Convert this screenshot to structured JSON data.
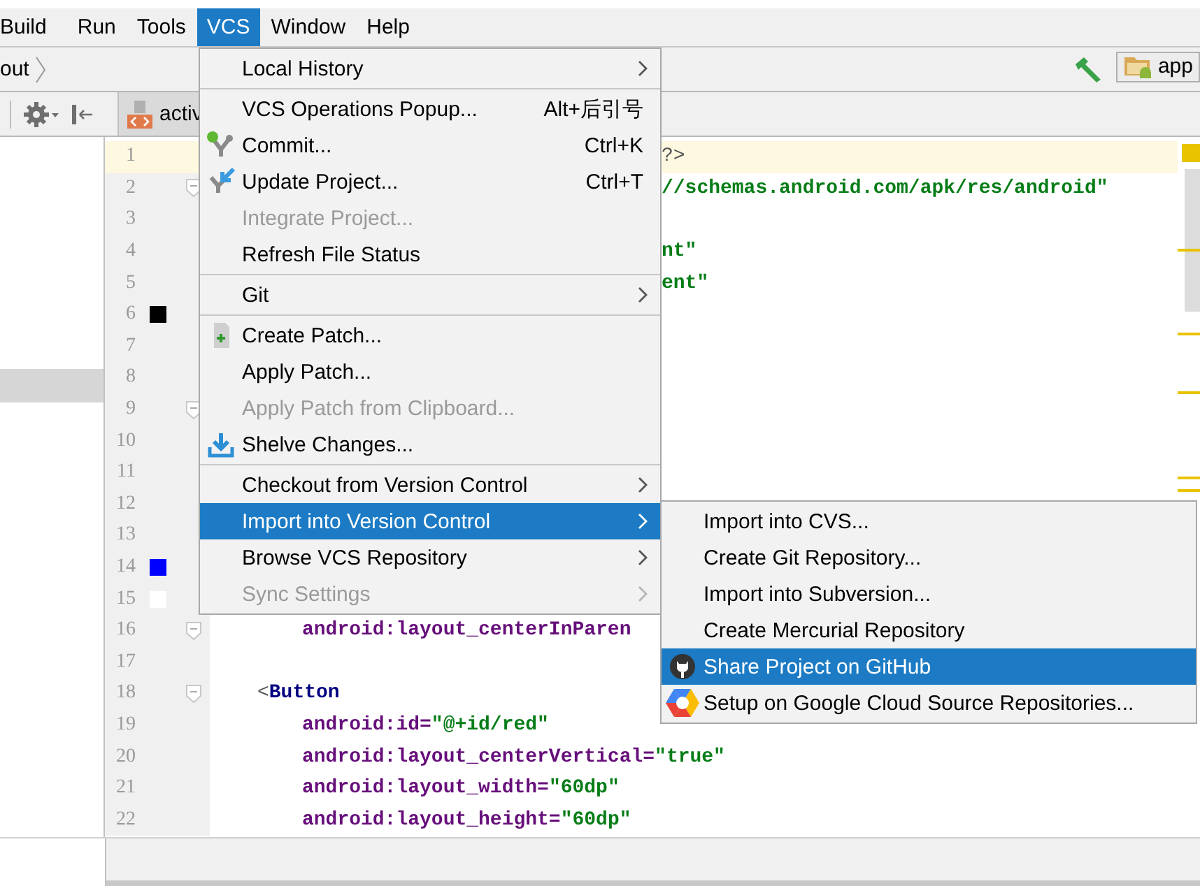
{
  "menubar": [
    {
      "label": "Build",
      "selected": false
    },
    {
      "label": "Run",
      "selected": false
    },
    {
      "label": "Tools",
      "selected": false
    },
    {
      "label": "VCS",
      "selected": true
    },
    {
      "label": "Window",
      "selected": false
    },
    {
      "label": "Help",
      "selected": false
    }
  ],
  "breadcrumb": "out",
  "run_config": "app",
  "tabs": [
    {
      "label": "activ",
      "selected": true
    }
  ],
  "editor": {
    "lines": [
      {
        "number": "1",
        "kind": "tail",
        "current": true,
        "fold": false,
        "parts": [
          {
            "kind": "punct",
            "text": "?>"
          }
        ]
      },
      {
        "number": "2",
        "kind": "tail",
        "current": false,
        "fold": true,
        "parts": [
          {
            "kind": "value",
            "text": "//schemas.android.com/apk/res/android\""
          }
        ]
      },
      {
        "number": "3",
        "kind": "tail",
        "current": false,
        "fold": false
      },
      {
        "number": "4",
        "kind": "tail",
        "current": false,
        "fold": false,
        "parts": [
          {
            "kind": "value",
            "text": "nt\""
          }
        ]
      },
      {
        "number": "5",
        "kind": "tail",
        "current": false,
        "fold": false,
        "parts": [
          {
            "kind": "value",
            "text": "ent\""
          }
        ]
      },
      {
        "number": "6",
        "kind": "tail",
        "current": false,
        "fold": false,
        "color": "#000000"
      },
      {
        "number": "7",
        "kind": "tail",
        "current": false,
        "fold": false
      },
      {
        "number": "8",
        "kind": "tail",
        "current": false,
        "fold": false
      },
      {
        "number": "9",
        "kind": "tail",
        "current": false,
        "fold": true
      },
      {
        "number": "10",
        "kind": "tail",
        "current": false,
        "fold": false
      },
      {
        "number": "11",
        "kind": "tail",
        "current": false,
        "fold": false
      },
      {
        "number": "12",
        "kind": "tail",
        "current": false,
        "fold": false
      },
      {
        "number": "13",
        "kind": "tail",
        "current": false,
        "fold": false
      },
      {
        "number": "14",
        "kind": "tail",
        "current": false,
        "fold": false,
        "color": "#0000ff"
      },
      {
        "number": "15",
        "kind": "tail",
        "current": false,
        "fold": false,
        "color": "#ffffff"
      },
      {
        "number": "16",
        "kind": "attr",
        "current": false,
        "fold": true,
        "parts": [
          {
            "kind": "attr",
            "text": "android:layout_centerInParen"
          }
        ]
      },
      {
        "number": "17",
        "kind": "attr",
        "current": false,
        "fold": false
      },
      {
        "number": "18",
        "kind": "tag",
        "current": false,
        "fold": true,
        "parts": [
          {
            "kind": "punct",
            "text": "<"
          },
          {
            "kind": "tag",
            "text": "Button"
          }
        ]
      },
      {
        "number": "19",
        "kind": "attr",
        "current": false,
        "fold": false,
        "parts": [
          {
            "kind": "attr",
            "text": "android:id="
          },
          {
            "kind": "value",
            "text": "\"@+id/red\""
          }
        ]
      },
      {
        "number": "20",
        "kind": "attr",
        "current": false,
        "fold": false,
        "parts": [
          {
            "kind": "attr",
            "text": "android:layout_centerVertical="
          },
          {
            "kind": "value",
            "text": "\"true\""
          }
        ]
      },
      {
        "number": "21",
        "kind": "attr",
        "current": false,
        "fold": false,
        "parts": [
          {
            "kind": "attr",
            "text": "android:layout_width="
          },
          {
            "kind": "value",
            "text": "\"60dp\""
          }
        ]
      },
      {
        "number": "22",
        "kind": "attr",
        "current": false,
        "fold": false,
        "parts": [
          {
            "kind": "attr",
            "text": "android:layout_height="
          },
          {
            "kind": "value",
            "text": "\"60dp\""
          }
        ]
      }
    ]
  },
  "vcs_menu": {
    "items": [
      {
        "kind": "item",
        "label": "Local History",
        "submenu": true,
        "disabled": false,
        "selected": false
      },
      {
        "kind": "separator"
      },
      {
        "kind": "item",
        "label": "VCS Operations Popup...",
        "shortcut": "Alt+后引号",
        "submenu": false,
        "disabled": false,
        "selected": false
      },
      {
        "kind": "commit",
        "label": "Commit...",
        "shortcut": "Ctrl+K",
        "submenu": false,
        "disabled": false,
        "selected": false
      },
      {
        "kind": "update",
        "label": "Update Project...",
        "shortcut": "Ctrl+T",
        "submenu": false,
        "disabled": false,
        "selected": false
      },
      {
        "kind": "item",
        "label": "Integrate Project...",
        "submenu": false,
        "disabled": true,
        "selected": false
      },
      {
        "kind": "item",
        "label": "Refresh File Status",
        "submenu": false,
        "disabled": false,
        "selected": false
      },
      {
        "kind": "separator"
      },
      {
        "kind": "item",
        "label": "Git",
        "submenu": true,
        "disabled": false,
        "selected": false
      },
      {
        "kind": "separator"
      },
      {
        "kind": "patch",
        "label": "Create Patch...",
        "submenu": false,
        "disabled": false,
        "selected": false
      },
      {
        "kind": "item",
        "label": "Apply Patch...",
        "submenu": false,
        "disabled": false,
        "selected": false
      },
      {
        "kind": "item",
        "label": "Apply Patch from Clipboard...",
        "submenu": false,
        "disabled": true,
        "selected": false
      },
      {
        "kind": "shelve",
        "label": "Shelve Changes...",
        "submenu": false,
        "disabled": false,
        "selected": false
      },
      {
        "kind": "separator"
      },
      {
        "kind": "item",
        "label": "Checkout from Version Control",
        "submenu": true,
        "disabled": false,
        "selected": false
      },
      {
        "kind": "item",
        "label": "Import into Version Control",
        "submenu": true,
        "disabled": false,
        "selected": true
      },
      {
        "kind": "item",
        "label": "Browse VCS Repository",
        "submenu": true,
        "disabled": false,
        "selected": false
      },
      {
        "kind": "item",
        "label": "Sync Settings",
        "submenu": true,
        "disabled": true,
        "selected": false
      }
    ]
  },
  "import_submenu": {
    "items": [
      {
        "kind": "item",
        "label": "Import into CVS...",
        "submenu": false,
        "disabled": false,
        "selected": false
      },
      {
        "kind": "item",
        "label": "Create Git Repository...",
        "submenu": false,
        "disabled": false,
        "selected": false
      },
      {
        "kind": "item",
        "label": "Import into Subversion...",
        "submenu": false,
        "disabled": false,
        "selected": false
      },
      {
        "kind": "item",
        "label": "Create Mercurial Repository",
        "submenu": false,
        "disabled": false,
        "selected": false
      },
      {
        "kind": "github",
        "label": "Share Project on GitHub",
        "submenu": false,
        "disabled": false,
        "selected": true
      },
      {
        "kind": "gcloud",
        "label": "Setup on Google Cloud Source Repositories...",
        "submenu": false,
        "disabled": false,
        "selected": false
      }
    ]
  }
}
